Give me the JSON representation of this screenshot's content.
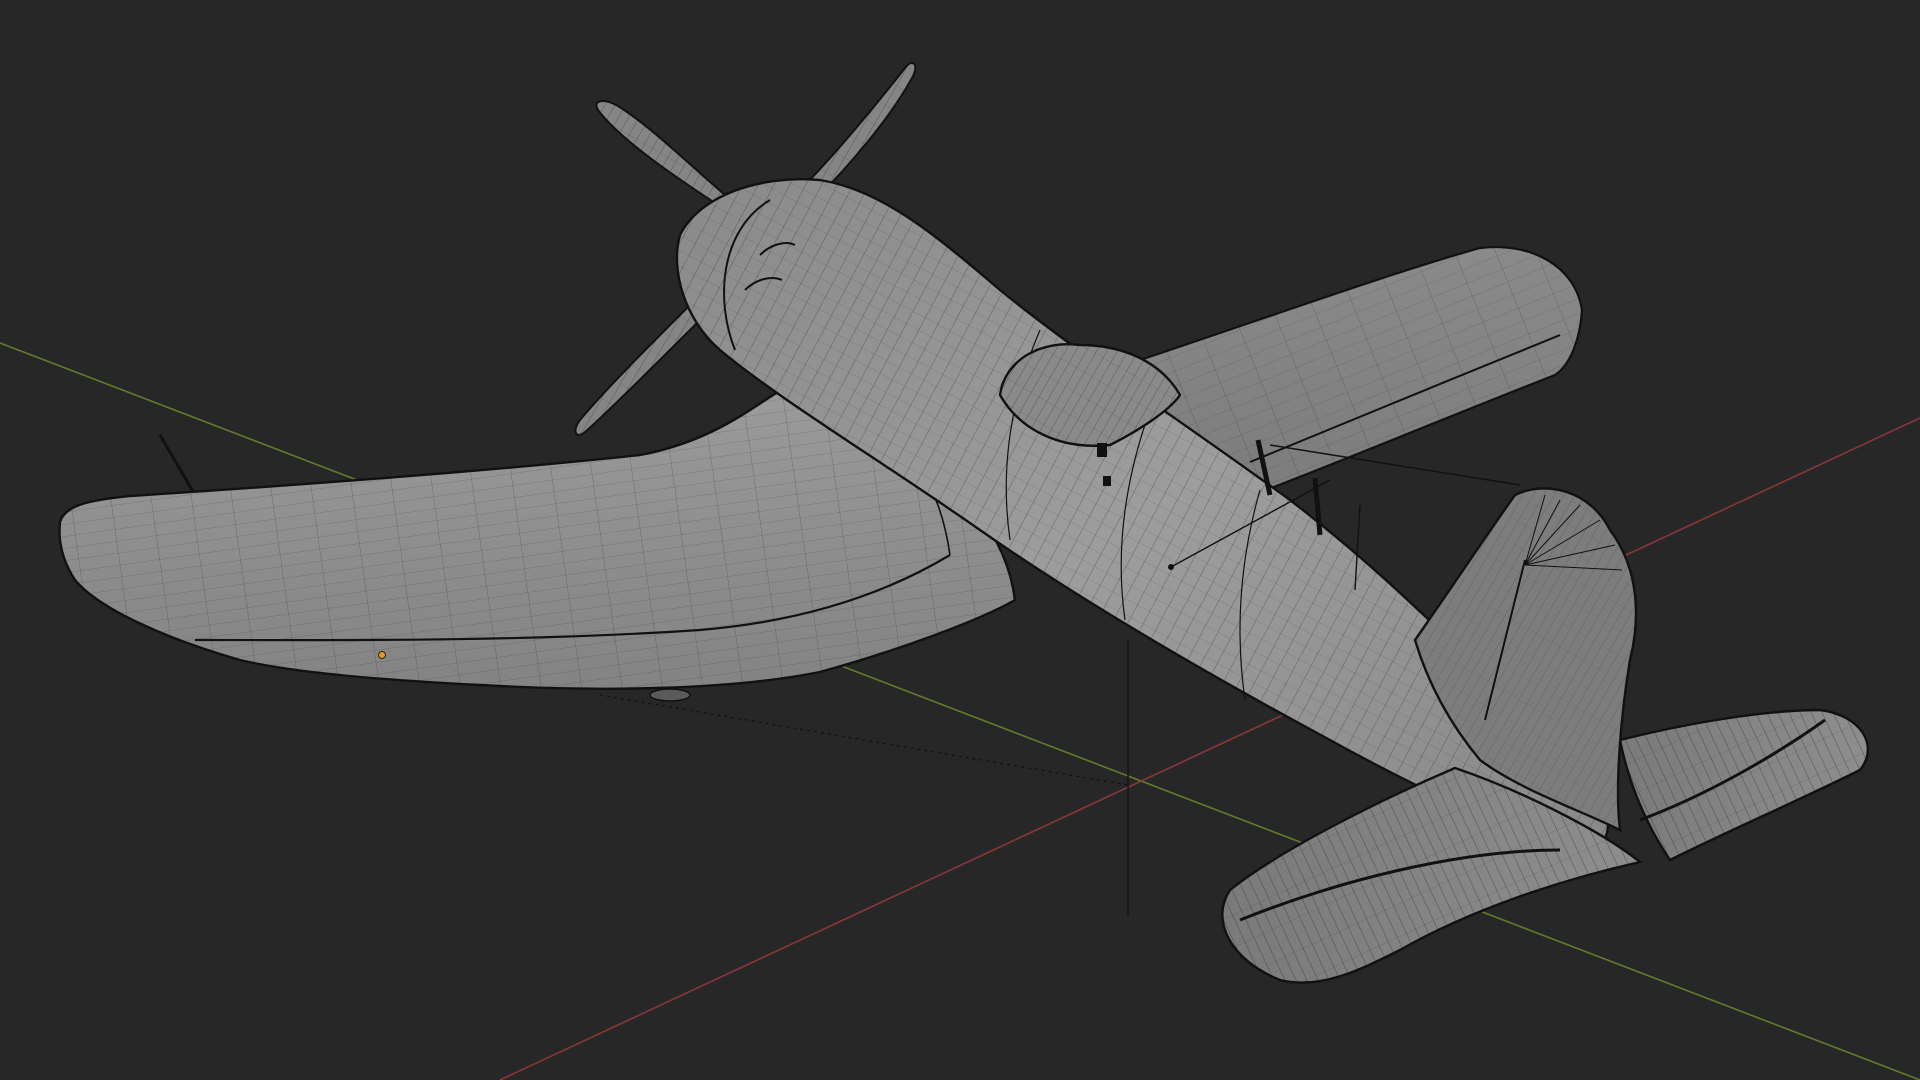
{
  "app": {
    "viewport_background": "#272727"
  },
  "colors": {
    "axis_x": "#9a3a3d",
    "axis_y": "#6a8a2c",
    "axis_z": "#121212",
    "mesh_fill": "#8f8f8f",
    "mesh_fill_dark": "#6f6f6f",
    "mesh_fill_light": "#a2a2a2",
    "wire": "#1a1a1a",
    "origin_dot": "#e09a2a"
  },
  "scene": {
    "object": "airplane-wireframe-mesh",
    "view_mode": "solid-with-wireframe-overlay",
    "shows_origin_marker": true,
    "shows_world_axes": [
      "x",
      "y",
      "z"
    ]
  }
}
